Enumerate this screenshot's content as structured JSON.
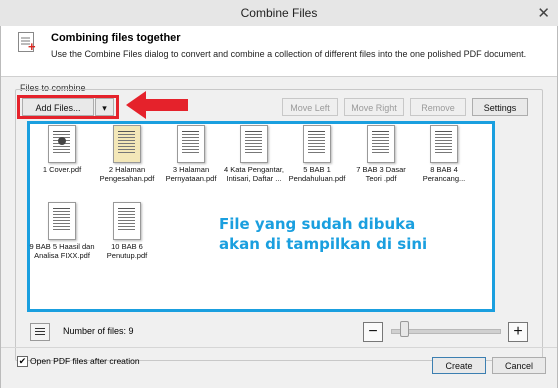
{
  "window": {
    "title": "Combine Files",
    "close_glyph": "✕"
  },
  "header": {
    "title": "Combining files together",
    "description": "Use the Combine Files dialog to convert and combine a collection of different files into the one polished PDF document."
  },
  "group_label": "Files to combine",
  "toolbar": {
    "add_files": "Add Files...",
    "dropdown_glyph": "▾",
    "move_left": "Move Left",
    "move_right": "Move Right",
    "remove": "Remove",
    "settings": "Settings"
  },
  "files": [
    {
      "name": "1 Cover.pdf",
      "style": "cover"
    },
    {
      "name": "2 Halaman Pengesahan.pdf",
      "style": "yellow"
    },
    {
      "name": "3 Halaman Pernyataan.pdf",
      "style": "plain"
    },
    {
      "name": "4 Kata Pengantar, Intisari, Daftar ...",
      "style": "plain"
    },
    {
      "name": "5 BAB 1 Pendahuluan.pdf",
      "style": "plain"
    },
    {
      "name": "7 BAB 3 Dasar Teori .pdf",
      "style": "plain"
    },
    {
      "name": "8 BAB 4 Perancang...",
      "style": "plain"
    },
    {
      "name": "9 BAB 5 Haasil dan Analisa FIXX.pdf",
      "style": "plain"
    },
    {
      "name": "10 BAB 6 Penutup.pdf",
      "style": "plain"
    }
  ],
  "overlay_text": {
    "line1": "File yang sudah dibuka",
    "line2": "akan di tampilkan di sini"
  },
  "footer": {
    "count_label": "Number of files: 9",
    "zoom_out": "−",
    "zoom_in": "+",
    "zoom_level": 0.1,
    "open_after": "Open PDF files after creation",
    "open_after_checked": true,
    "create": "Create",
    "cancel": "Cancel"
  },
  "colors": {
    "annotation_red": "#e5222b",
    "annotation_blue": "#1a9fdf"
  },
  "icons": [
    "close-icon",
    "combine-files-icon",
    "dropdown-arrow-icon",
    "list-view-icon",
    "zoom-out-icon",
    "zoom-in-icon",
    "checkbox-icon",
    "annotation-arrow-icon"
  ]
}
